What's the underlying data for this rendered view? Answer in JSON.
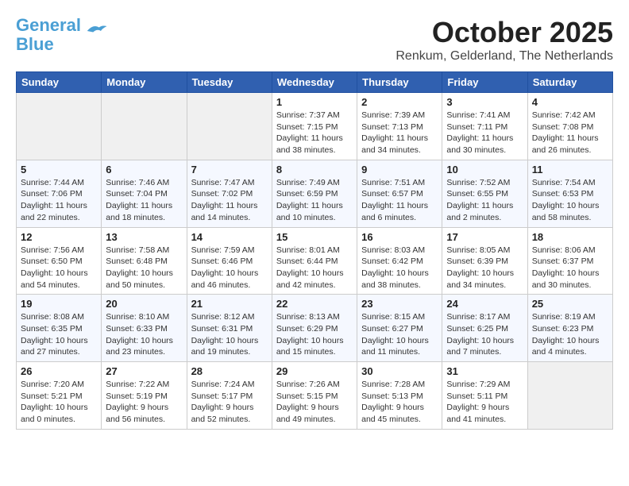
{
  "header": {
    "logo_line1": "General",
    "logo_line2": "Blue",
    "month": "October 2025",
    "location": "Renkum, Gelderland, The Netherlands"
  },
  "days_of_week": [
    "Sunday",
    "Monday",
    "Tuesday",
    "Wednesday",
    "Thursday",
    "Friday",
    "Saturday"
  ],
  "weeks": [
    [
      {
        "day": "",
        "info": ""
      },
      {
        "day": "",
        "info": ""
      },
      {
        "day": "",
        "info": ""
      },
      {
        "day": "1",
        "info": "Sunrise: 7:37 AM\nSunset: 7:15 PM\nDaylight: 11 hours\nand 38 minutes."
      },
      {
        "day": "2",
        "info": "Sunrise: 7:39 AM\nSunset: 7:13 PM\nDaylight: 11 hours\nand 34 minutes."
      },
      {
        "day": "3",
        "info": "Sunrise: 7:41 AM\nSunset: 7:11 PM\nDaylight: 11 hours\nand 30 minutes."
      },
      {
        "day": "4",
        "info": "Sunrise: 7:42 AM\nSunset: 7:08 PM\nDaylight: 11 hours\nand 26 minutes."
      }
    ],
    [
      {
        "day": "5",
        "info": "Sunrise: 7:44 AM\nSunset: 7:06 PM\nDaylight: 11 hours\nand 22 minutes."
      },
      {
        "day": "6",
        "info": "Sunrise: 7:46 AM\nSunset: 7:04 PM\nDaylight: 11 hours\nand 18 minutes."
      },
      {
        "day": "7",
        "info": "Sunrise: 7:47 AM\nSunset: 7:02 PM\nDaylight: 11 hours\nand 14 minutes."
      },
      {
        "day": "8",
        "info": "Sunrise: 7:49 AM\nSunset: 6:59 PM\nDaylight: 11 hours\nand 10 minutes."
      },
      {
        "day": "9",
        "info": "Sunrise: 7:51 AM\nSunset: 6:57 PM\nDaylight: 11 hours\nand 6 minutes."
      },
      {
        "day": "10",
        "info": "Sunrise: 7:52 AM\nSunset: 6:55 PM\nDaylight: 11 hours\nand 2 minutes."
      },
      {
        "day": "11",
        "info": "Sunrise: 7:54 AM\nSunset: 6:53 PM\nDaylight: 10 hours\nand 58 minutes."
      }
    ],
    [
      {
        "day": "12",
        "info": "Sunrise: 7:56 AM\nSunset: 6:50 PM\nDaylight: 10 hours\nand 54 minutes."
      },
      {
        "day": "13",
        "info": "Sunrise: 7:58 AM\nSunset: 6:48 PM\nDaylight: 10 hours\nand 50 minutes."
      },
      {
        "day": "14",
        "info": "Sunrise: 7:59 AM\nSunset: 6:46 PM\nDaylight: 10 hours\nand 46 minutes."
      },
      {
        "day": "15",
        "info": "Sunrise: 8:01 AM\nSunset: 6:44 PM\nDaylight: 10 hours\nand 42 minutes."
      },
      {
        "day": "16",
        "info": "Sunrise: 8:03 AM\nSunset: 6:42 PM\nDaylight: 10 hours\nand 38 minutes."
      },
      {
        "day": "17",
        "info": "Sunrise: 8:05 AM\nSunset: 6:39 PM\nDaylight: 10 hours\nand 34 minutes."
      },
      {
        "day": "18",
        "info": "Sunrise: 8:06 AM\nSunset: 6:37 PM\nDaylight: 10 hours\nand 30 minutes."
      }
    ],
    [
      {
        "day": "19",
        "info": "Sunrise: 8:08 AM\nSunset: 6:35 PM\nDaylight: 10 hours\nand 27 minutes."
      },
      {
        "day": "20",
        "info": "Sunrise: 8:10 AM\nSunset: 6:33 PM\nDaylight: 10 hours\nand 23 minutes."
      },
      {
        "day": "21",
        "info": "Sunrise: 8:12 AM\nSunset: 6:31 PM\nDaylight: 10 hours\nand 19 minutes."
      },
      {
        "day": "22",
        "info": "Sunrise: 8:13 AM\nSunset: 6:29 PM\nDaylight: 10 hours\nand 15 minutes."
      },
      {
        "day": "23",
        "info": "Sunrise: 8:15 AM\nSunset: 6:27 PM\nDaylight: 10 hours\nand 11 minutes."
      },
      {
        "day": "24",
        "info": "Sunrise: 8:17 AM\nSunset: 6:25 PM\nDaylight: 10 hours\nand 7 minutes."
      },
      {
        "day": "25",
        "info": "Sunrise: 8:19 AM\nSunset: 6:23 PM\nDaylight: 10 hours\nand 4 minutes."
      }
    ],
    [
      {
        "day": "26",
        "info": "Sunrise: 7:20 AM\nSunset: 5:21 PM\nDaylight: 10 hours\nand 0 minutes."
      },
      {
        "day": "27",
        "info": "Sunrise: 7:22 AM\nSunset: 5:19 PM\nDaylight: 9 hours\nand 56 minutes."
      },
      {
        "day": "28",
        "info": "Sunrise: 7:24 AM\nSunset: 5:17 PM\nDaylight: 9 hours\nand 52 minutes."
      },
      {
        "day": "29",
        "info": "Sunrise: 7:26 AM\nSunset: 5:15 PM\nDaylight: 9 hours\nand 49 minutes."
      },
      {
        "day": "30",
        "info": "Sunrise: 7:28 AM\nSunset: 5:13 PM\nDaylight: 9 hours\nand 45 minutes."
      },
      {
        "day": "31",
        "info": "Sunrise: 7:29 AM\nSunset: 5:11 PM\nDaylight: 9 hours\nand 41 minutes."
      },
      {
        "day": "",
        "info": ""
      }
    ]
  ]
}
